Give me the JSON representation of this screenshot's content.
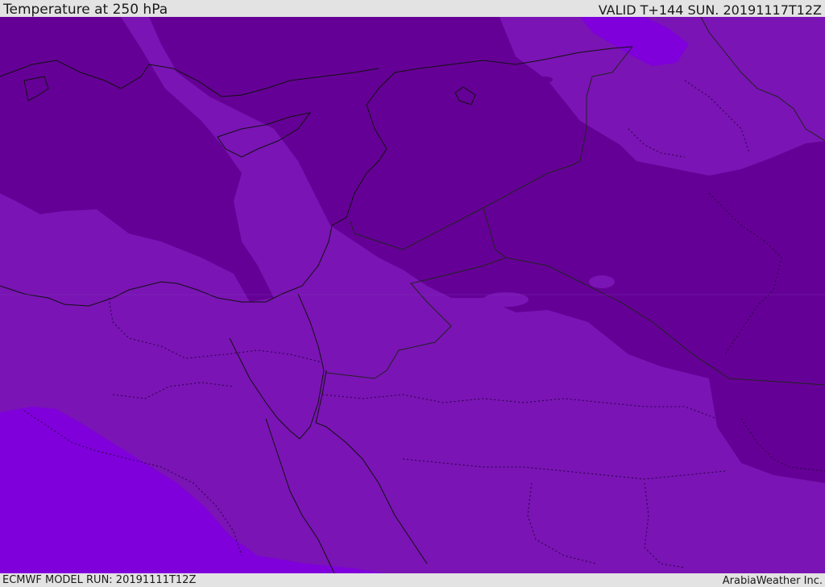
{
  "header": {
    "title": "Temperature at 250 hPa",
    "valid": "VALID T+144 SUN. 20191117T12Z"
  },
  "footer": {
    "model_run": "ECMWF MODEL RUN: 20191111T12Z",
    "credit": "ArabiaWeather Inc."
  },
  "map": {
    "region": "Eastern Mediterranean / Middle East",
    "colors": {
      "cold_band": "#650096",
      "mid_band": "#7a14b4",
      "warm_band": "#7f00db",
      "coast_line": "#111111",
      "border_line": "#222222"
    }
  }
}
